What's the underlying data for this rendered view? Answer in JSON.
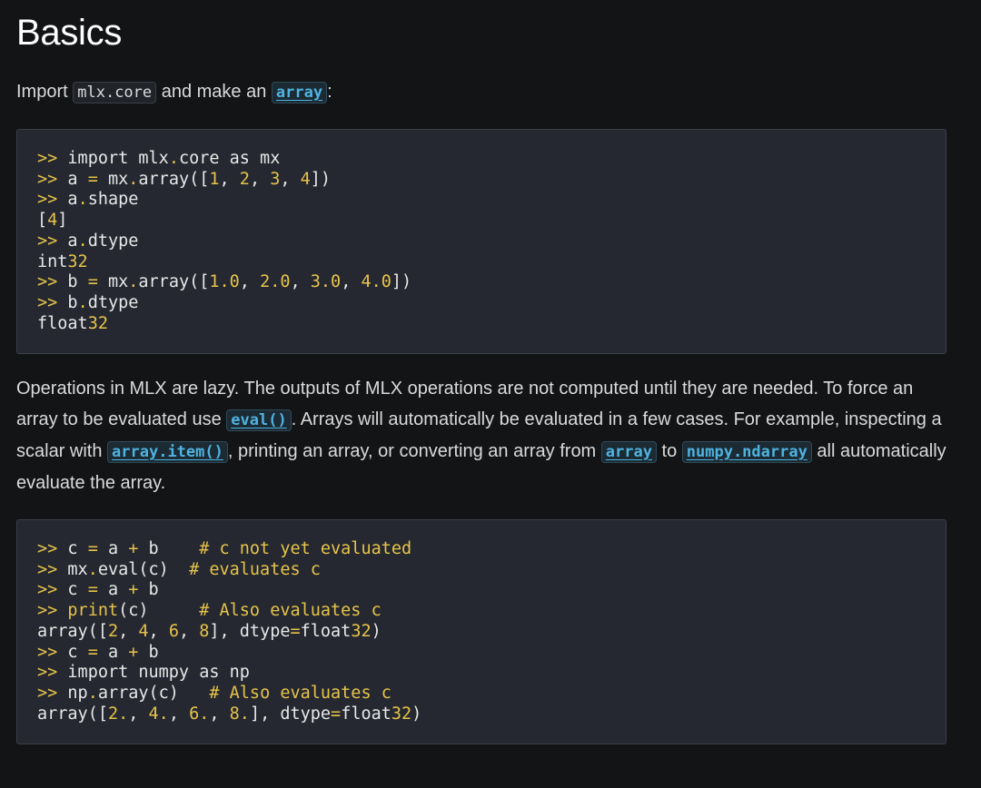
{
  "heading": "Basics",
  "intro": {
    "before": "Import ",
    "code1": "mlx.core",
    "middle": " and make an ",
    "code2": "array",
    "after": ":"
  },
  "code_block_1": [
    ">> import mlx.core as mx",
    ">> a = mx.array([1, 2, 3, 4])",
    ">> a.shape",
    "[4]",
    ">> a.dtype",
    "int32",
    ">> b = mx.array([1.0, 2.0, 3.0, 4.0])",
    ">> b.dtype",
    "float32"
  ],
  "paragraph": {
    "t1": "Operations in MLX are lazy. The outputs of MLX operations are not computed until they are needed. To force an array to be evaluated use ",
    "link_eval": "eval()",
    "t2": ". Arrays will automatically be evaluated in a few cases. For example, inspecting a scalar with ",
    "link_item": "array.item()",
    "t3": ", printing an array, or converting an array from ",
    "link_array": "array",
    "t4": " to ",
    "link_ndarray": "numpy.ndarray",
    "t5": " all automatically evaluate the array."
  },
  "code_block_2": [
    ">> c = a + b    # c not yet evaluated",
    ">> mx.eval(c)  # evaluates c",
    ">> c = a + b",
    ">> print(c)     # Also evaluates c",
    "array([2, 4, 6, 8], dtype=float32)",
    ">> c = a + b",
    ">> import numpy as np",
    ">> np.array(c)   # Also evaluates c",
    "array([2., 4., 6., 8.], dtype=float32)"
  ],
  "colors": {
    "background": "#131416",
    "code_bg": "#252830",
    "accent_link": "#4fb3e0",
    "syntax_yellow": "#e6c34a"
  }
}
